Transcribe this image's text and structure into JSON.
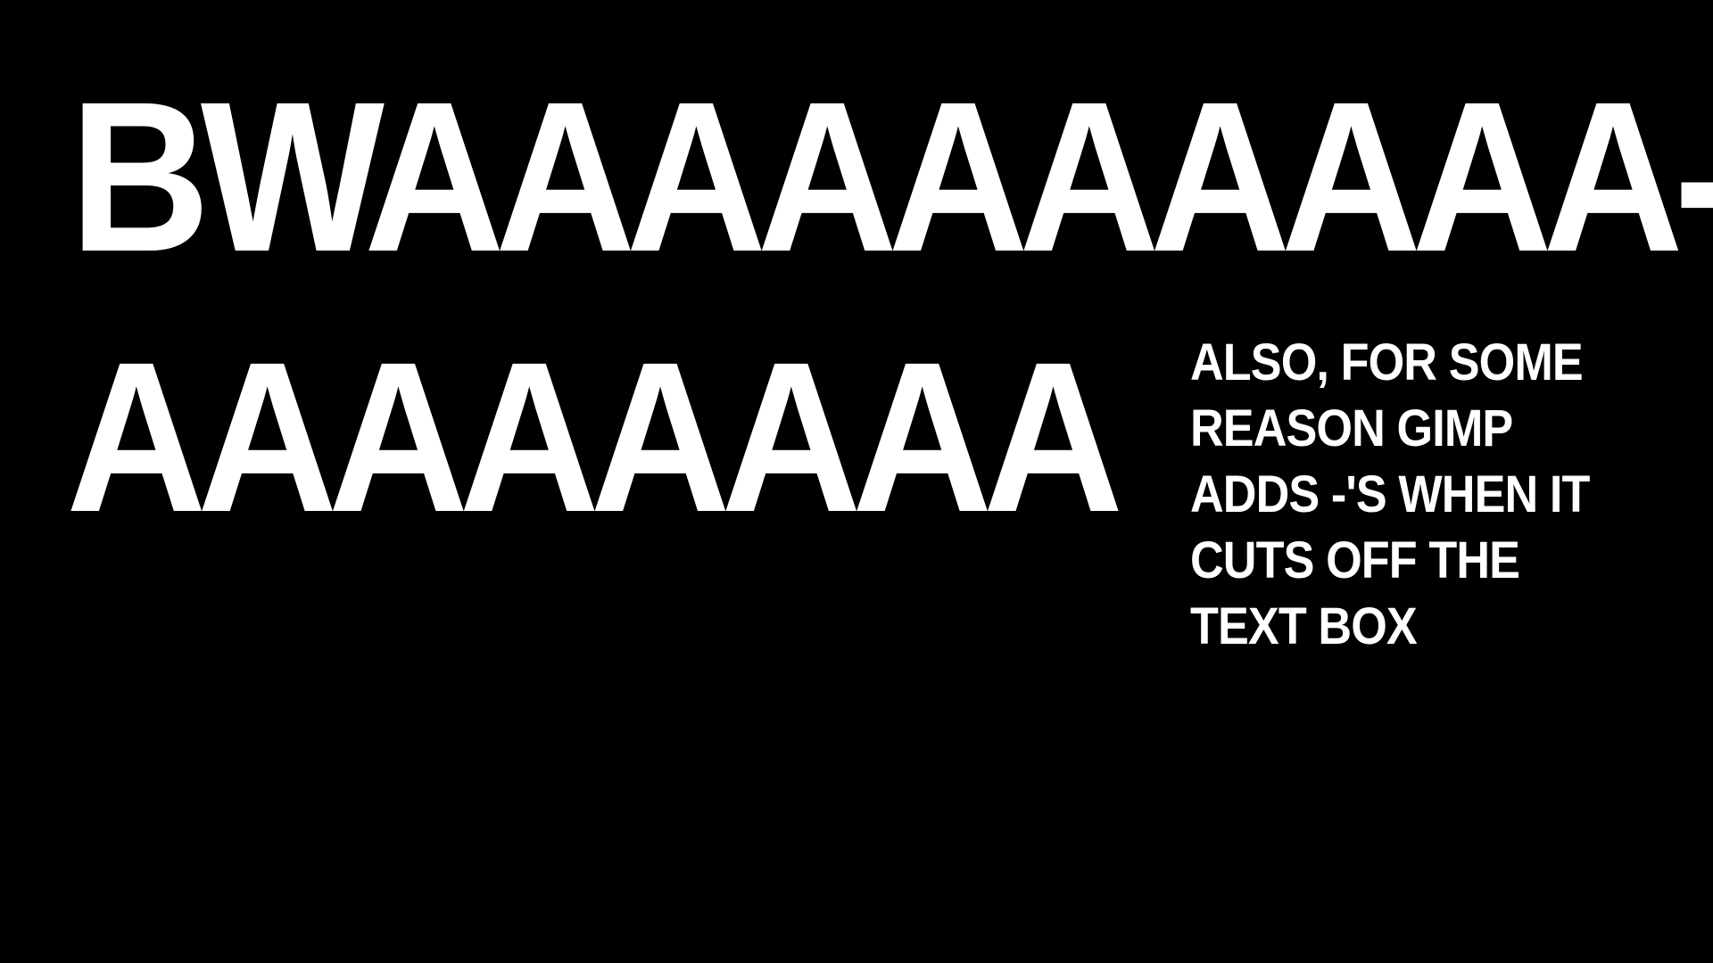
{
  "page": {
    "background_color": "#000000",
    "text_color": "#ffffff"
  },
  "main_text": {
    "line1": "BWAAAAAAAAAA-",
    "line2": "AAAAAAAA"
  },
  "side_note": {
    "lines": [
      "ALSO, FOR SOME",
      "REASON GIMP",
      "ADDS -'S WHEN IT",
      "CUTS OFF THE",
      "TEXT BOX"
    ]
  }
}
